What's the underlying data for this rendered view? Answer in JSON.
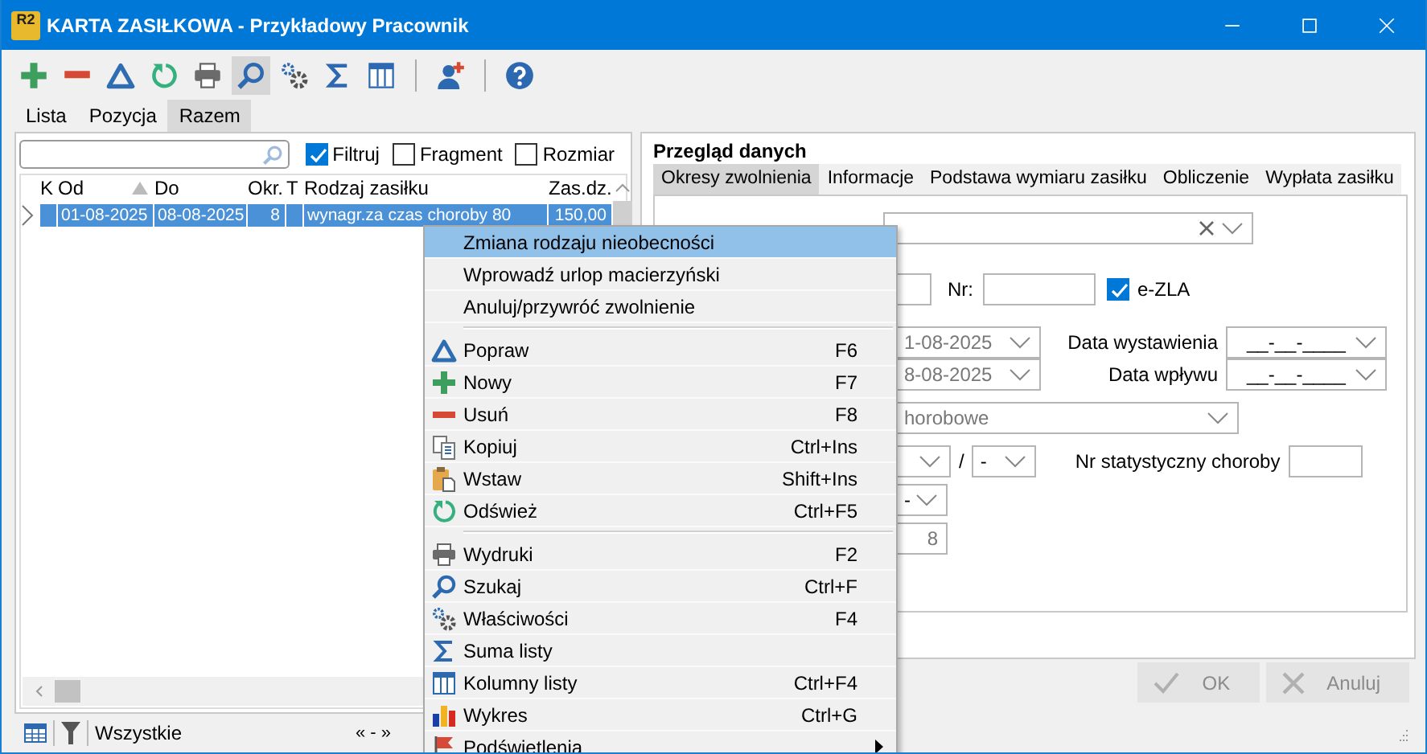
{
  "window": {
    "logo": "R2",
    "title": "KARTA ZASIŁKOWA - Przykładowy Pracownik"
  },
  "toolbar": [
    {
      "pressed": false
    },
    {
      "pressed": false
    },
    {
      "pressed": false
    },
    {
      "pressed": false
    },
    {
      "pressed": false
    },
    {
      "pressed": true
    },
    {
      "pressed": false
    },
    {
      "pressed": false
    },
    {
      "pressed": false
    },
    {
      "pressed": false
    },
    {
      "pressed": false
    }
  ],
  "view_tabs": [
    {
      "label": "Lista",
      "selected": false
    },
    {
      "label": "Pozycja",
      "selected": false
    },
    {
      "label": "Razem",
      "selected": true
    }
  ],
  "filters": [
    {
      "label": "Filtruj",
      "checked": true
    },
    {
      "label": "Fragment",
      "checked": false
    },
    {
      "label": "Rozmiar",
      "checked": false
    }
  ],
  "table": {
    "columns": [
      {
        "label": "K",
        "sorted": false
      },
      {
        "label": "Od",
        "sorted": true
      },
      {
        "label": "Do",
        "sorted": false
      },
      {
        "label": "Okr.",
        "sorted": false
      },
      {
        "label": "T",
        "sorted": false
      },
      {
        "label": "Rodzaj zasiłku",
        "sorted": false
      },
      {
        "label": "Zas.dz.",
        "sorted": false
      }
    ],
    "rows": [
      {
        "selected": true,
        "od": "01-08-2025",
        "do": "08-08-2025",
        "okr": "8",
        "rodzaj": "wynagr.za czas choroby 80",
        "zas": "150,00"
      }
    ]
  },
  "status_bar": {
    "filter": "Wszystkie",
    "nav": "« - »"
  },
  "details": {
    "title": "Przegląd danych",
    "tabs": [
      {
        "label": "Okresy zwolnienia",
        "selected": true
      },
      {
        "label": "Informacje",
        "selected": false
      },
      {
        "label": "Podstawa wymiaru zasiłku",
        "selected": false
      },
      {
        "label": "Obliczenie",
        "selected": false
      },
      {
        "label": "Wypłata zasiłku",
        "selected": false
      }
    ],
    "nr_label": "Nr:",
    "ezla": {
      "label": "e-ZLA",
      "checked": true
    },
    "date_from": "1-08-2025",
    "date_to": "8-08-2025",
    "issue_date": {
      "label": "Data wystawienia",
      "value": "__-__-____"
    },
    "receipt_date": {
      "label": "Data wpływu",
      "value": "__-__-____"
    },
    "benefit_type": "horobowe",
    "slash": "/",
    "code_2": "-",
    "stat_label": "Nr statystyczny choroby",
    "code_3": "-",
    "days": "8",
    "buttons": [
      {
        "label": "OK",
        "disabled": true
      },
      {
        "label": "Anuluj",
        "disabled": true
      }
    ]
  },
  "context_menu": {
    "groups": [
      [
        {
          "label": "Zmiana rodzaju nieobecności",
          "selected": true,
          "submenu": false
        },
        {
          "label": "Wprowadź urlop macierzyński",
          "selected": false,
          "submenu": false
        },
        {
          "label": "Anuluj/przywróć zwolnienie",
          "selected": false,
          "submenu": false
        }
      ],
      [
        {
          "label": "Popraw",
          "shortcut": "F6",
          "selected": false,
          "submenu": false
        },
        {
          "label": "Nowy",
          "shortcut": "F7",
          "selected": false,
          "submenu": false
        },
        {
          "label": "Usuń",
          "shortcut": "F8",
          "selected": false,
          "submenu": false
        },
        {
          "label": "Kopiuj",
          "shortcut": "Ctrl+Ins",
          "selected": false,
          "submenu": false
        },
        {
          "label": "Wstaw",
          "shortcut": "Shift+Ins",
          "selected": false,
          "submenu": false
        },
        {
          "label": "Odśwież",
          "shortcut": "Ctrl+F5",
          "selected": false,
          "submenu": false
        }
      ],
      [
        {
          "label": "Wydruki",
          "shortcut": "F2",
          "selected": false,
          "submenu": false
        },
        {
          "label": "Szukaj",
          "shortcut": "Ctrl+F",
          "selected": false,
          "submenu": false
        },
        {
          "label": "Właściwości",
          "shortcut": "F4",
          "selected": false,
          "submenu": false
        },
        {
          "label": "Suma listy",
          "selected": false,
          "submenu": false
        },
        {
          "label": "Kolumny listy",
          "shortcut": "Ctrl+F4",
          "selected": false,
          "submenu": false
        },
        {
          "label": "Wykres",
          "shortcut": "Ctrl+G",
          "selected": false,
          "submenu": false
        },
        {
          "label": "Podświetlenia",
          "selected": false,
          "submenu": true
        }
      ]
    ]
  }
}
